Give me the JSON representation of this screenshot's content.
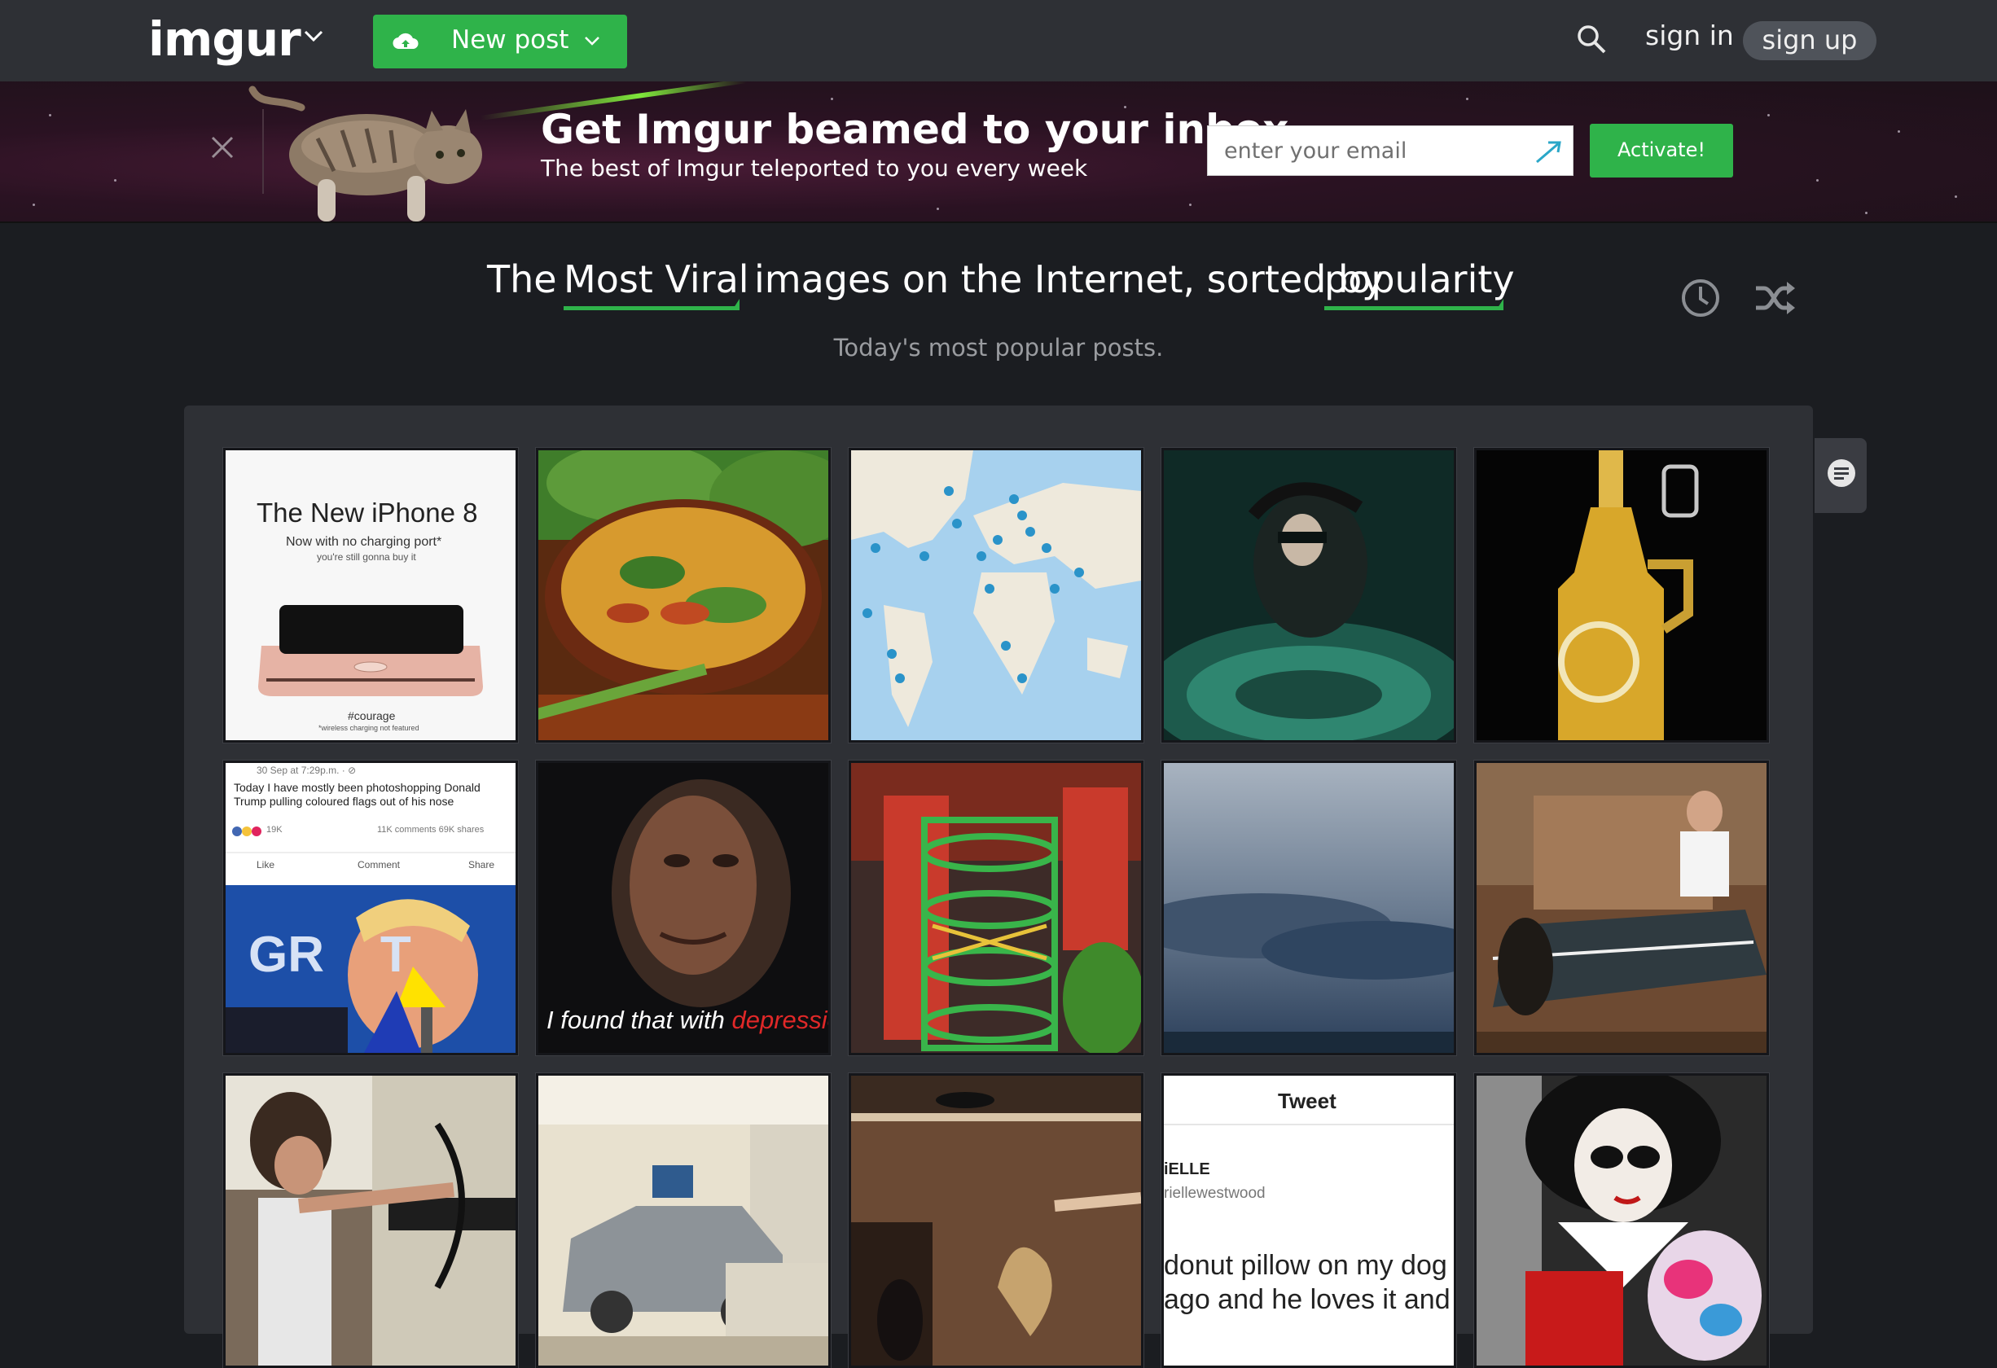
{
  "topbar": {
    "logo": "imgur",
    "new_post": "New post",
    "sign_in": "sign in",
    "sign_up": "sign up"
  },
  "banner": {
    "title": "Get Imgur beamed to your inbox",
    "subtitle": "The best of Imgur teleported to you every week",
    "email_placeholder": "enter your email",
    "activate": "Activate!"
  },
  "heading": {
    "the": "The",
    "section": "Most Viral",
    "middle": "images on the Internet, sorted by",
    "sort": "popularity",
    "subtitle": "Today's most popular posts."
  },
  "posts": {
    "iphone": {
      "title": "The New iPhone 8",
      "line1": "Now with no charging port*",
      "line2": "you're still gonna buy it",
      "hashtag": "#courage",
      "footnote": "*wireless charging not featured"
    },
    "trump": {
      "timestamp": "30 Sep at 7:29p.m. · ⊘",
      "post_text": "Today I have mostly been photoshopping Donald Trump pulling coloured flags out of his nose",
      "reactions": "19K",
      "stats": "11K comments 69K shares",
      "like": "Like",
      "comment": "Comment",
      "share": "Share",
      "sign": "GR    T"
    },
    "rock": {
      "caption_a": "I found that with",
      "caption_b": "depression"
    },
    "tweet": {
      "header": "Tweet",
      "name": "iELLE",
      "handle": "riellewestwood",
      "line1": "donut pillow on my dog",
      "line2": "ago and he loves it and w"
    }
  },
  "colors": {
    "accent": "#2fb34a",
    "topbar": "#2e3035",
    "page": "#1b1d21"
  }
}
